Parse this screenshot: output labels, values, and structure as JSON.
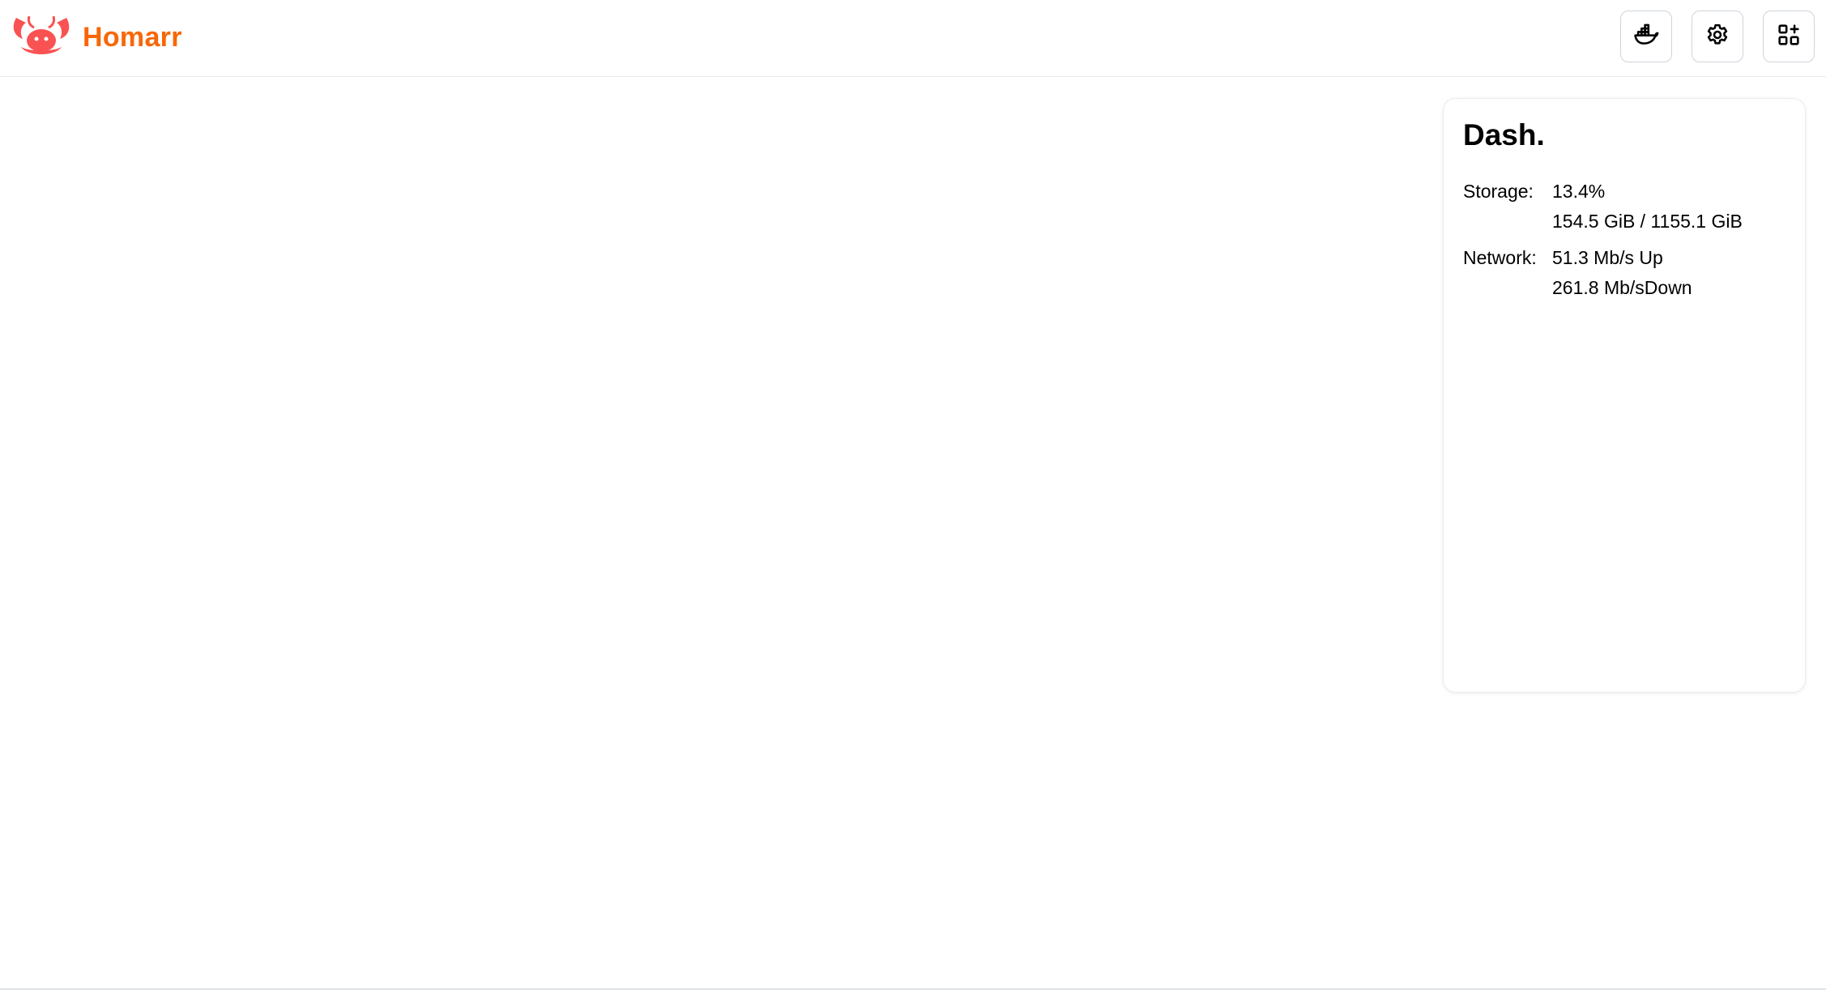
{
  "colors": {
    "brand": "#fa5252",
    "brand_text": "#f76707"
  },
  "header": {
    "brand_name": "Homarr",
    "actions": [
      {
        "icon": "docker-icon"
      },
      {
        "icon": "gear-icon"
      },
      {
        "icon": "add-widget-icon"
      }
    ]
  },
  "widget": {
    "title": "Dash.",
    "storage": {
      "label": "Storage:",
      "percent": "13.4%",
      "usage": "154.5 GiB / 1155.1 GiB"
    },
    "network": {
      "label": "Network:",
      "up": "51.3 Mb/s Up",
      "down": "261.8 Mb/sDown"
    }
  }
}
